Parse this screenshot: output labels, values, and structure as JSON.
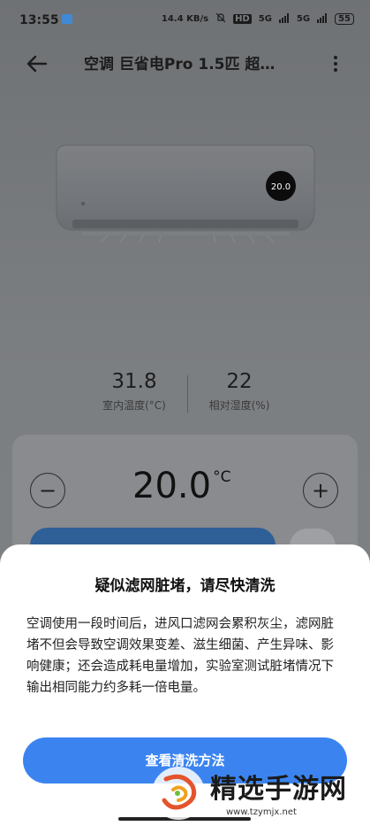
{
  "status_bar": {
    "time": "13:55",
    "net_speed": "14.4 KB/s",
    "hd_label": "HD",
    "sig1": "5G",
    "sig2": "5G",
    "battery": "55"
  },
  "header": {
    "title": "空调 巨省电Pro 1.5匹 超…"
  },
  "device": {
    "display_temp": "20.0"
  },
  "stats": {
    "indoor_temp_value": "31.8",
    "indoor_temp_label": "室内温度(°C)",
    "humidity_value": "22",
    "humidity_label": "相对湿度(%)"
  },
  "control": {
    "temperature": "20.0",
    "unit": "°C",
    "minus": "−",
    "plus": "+"
  },
  "sheet": {
    "title": "疑似滤网脏堵，请尽快清洗",
    "body": "空调使用一段时间后，进风口滤网会累积灰尘，滤网脏堵不但会导致空调效果变差、滋生细菌、产生异味、影响健康；还会造成耗电量增加，实验室测试脏堵情况下输出相同能力约多耗一倍电量。",
    "button_label": "查看清洗方法"
  },
  "watermark": {
    "text": "精选手游网",
    "url": "www.tzymjx.net"
  },
  "colors": {
    "primary": "#3b84f0",
    "overlay": "#777a7d"
  }
}
